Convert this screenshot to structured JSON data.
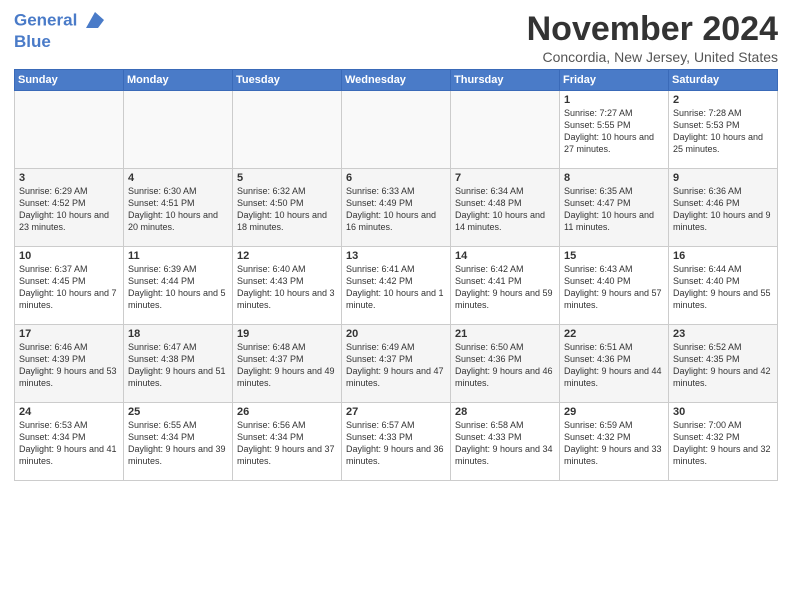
{
  "header": {
    "logo_line1": "General",
    "logo_line2": "Blue",
    "month": "November 2024",
    "location": "Concordia, New Jersey, United States"
  },
  "weekdays": [
    "Sunday",
    "Monday",
    "Tuesday",
    "Wednesday",
    "Thursday",
    "Friday",
    "Saturday"
  ],
  "weeks": [
    [
      {
        "day": "",
        "info": ""
      },
      {
        "day": "",
        "info": ""
      },
      {
        "day": "",
        "info": ""
      },
      {
        "day": "",
        "info": ""
      },
      {
        "day": "",
        "info": ""
      },
      {
        "day": "1",
        "info": "Sunrise: 7:27 AM\nSunset: 5:55 PM\nDaylight: 10 hours and 27 minutes."
      },
      {
        "day": "2",
        "info": "Sunrise: 7:28 AM\nSunset: 5:53 PM\nDaylight: 10 hours and 25 minutes."
      }
    ],
    [
      {
        "day": "3",
        "info": "Sunrise: 6:29 AM\nSunset: 4:52 PM\nDaylight: 10 hours and 23 minutes."
      },
      {
        "day": "4",
        "info": "Sunrise: 6:30 AM\nSunset: 4:51 PM\nDaylight: 10 hours and 20 minutes."
      },
      {
        "day": "5",
        "info": "Sunrise: 6:32 AM\nSunset: 4:50 PM\nDaylight: 10 hours and 18 minutes."
      },
      {
        "day": "6",
        "info": "Sunrise: 6:33 AM\nSunset: 4:49 PM\nDaylight: 10 hours and 16 minutes."
      },
      {
        "day": "7",
        "info": "Sunrise: 6:34 AM\nSunset: 4:48 PM\nDaylight: 10 hours and 14 minutes."
      },
      {
        "day": "8",
        "info": "Sunrise: 6:35 AM\nSunset: 4:47 PM\nDaylight: 10 hours and 11 minutes."
      },
      {
        "day": "9",
        "info": "Sunrise: 6:36 AM\nSunset: 4:46 PM\nDaylight: 10 hours and 9 minutes."
      }
    ],
    [
      {
        "day": "10",
        "info": "Sunrise: 6:37 AM\nSunset: 4:45 PM\nDaylight: 10 hours and 7 minutes."
      },
      {
        "day": "11",
        "info": "Sunrise: 6:39 AM\nSunset: 4:44 PM\nDaylight: 10 hours and 5 minutes."
      },
      {
        "day": "12",
        "info": "Sunrise: 6:40 AM\nSunset: 4:43 PM\nDaylight: 10 hours and 3 minutes."
      },
      {
        "day": "13",
        "info": "Sunrise: 6:41 AM\nSunset: 4:42 PM\nDaylight: 10 hours and 1 minute."
      },
      {
        "day": "14",
        "info": "Sunrise: 6:42 AM\nSunset: 4:41 PM\nDaylight: 9 hours and 59 minutes."
      },
      {
        "day": "15",
        "info": "Sunrise: 6:43 AM\nSunset: 4:40 PM\nDaylight: 9 hours and 57 minutes."
      },
      {
        "day": "16",
        "info": "Sunrise: 6:44 AM\nSunset: 4:40 PM\nDaylight: 9 hours and 55 minutes."
      }
    ],
    [
      {
        "day": "17",
        "info": "Sunrise: 6:46 AM\nSunset: 4:39 PM\nDaylight: 9 hours and 53 minutes."
      },
      {
        "day": "18",
        "info": "Sunrise: 6:47 AM\nSunset: 4:38 PM\nDaylight: 9 hours and 51 minutes."
      },
      {
        "day": "19",
        "info": "Sunrise: 6:48 AM\nSunset: 4:37 PM\nDaylight: 9 hours and 49 minutes."
      },
      {
        "day": "20",
        "info": "Sunrise: 6:49 AM\nSunset: 4:37 PM\nDaylight: 9 hours and 47 minutes."
      },
      {
        "day": "21",
        "info": "Sunrise: 6:50 AM\nSunset: 4:36 PM\nDaylight: 9 hours and 46 minutes."
      },
      {
        "day": "22",
        "info": "Sunrise: 6:51 AM\nSunset: 4:36 PM\nDaylight: 9 hours and 44 minutes."
      },
      {
        "day": "23",
        "info": "Sunrise: 6:52 AM\nSunset: 4:35 PM\nDaylight: 9 hours and 42 minutes."
      }
    ],
    [
      {
        "day": "24",
        "info": "Sunrise: 6:53 AM\nSunset: 4:34 PM\nDaylight: 9 hours and 41 minutes."
      },
      {
        "day": "25",
        "info": "Sunrise: 6:55 AM\nSunset: 4:34 PM\nDaylight: 9 hours and 39 minutes."
      },
      {
        "day": "26",
        "info": "Sunrise: 6:56 AM\nSunset: 4:34 PM\nDaylight: 9 hours and 37 minutes."
      },
      {
        "day": "27",
        "info": "Sunrise: 6:57 AM\nSunset: 4:33 PM\nDaylight: 9 hours and 36 minutes."
      },
      {
        "day": "28",
        "info": "Sunrise: 6:58 AM\nSunset: 4:33 PM\nDaylight: 9 hours and 34 minutes."
      },
      {
        "day": "29",
        "info": "Sunrise: 6:59 AM\nSunset: 4:32 PM\nDaylight: 9 hours and 33 minutes."
      },
      {
        "day": "30",
        "info": "Sunrise: 7:00 AM\nSunset: 4:32 PM\nDaylight: 9 hours and 32 minutes."
      }
    ]
  ]
}
